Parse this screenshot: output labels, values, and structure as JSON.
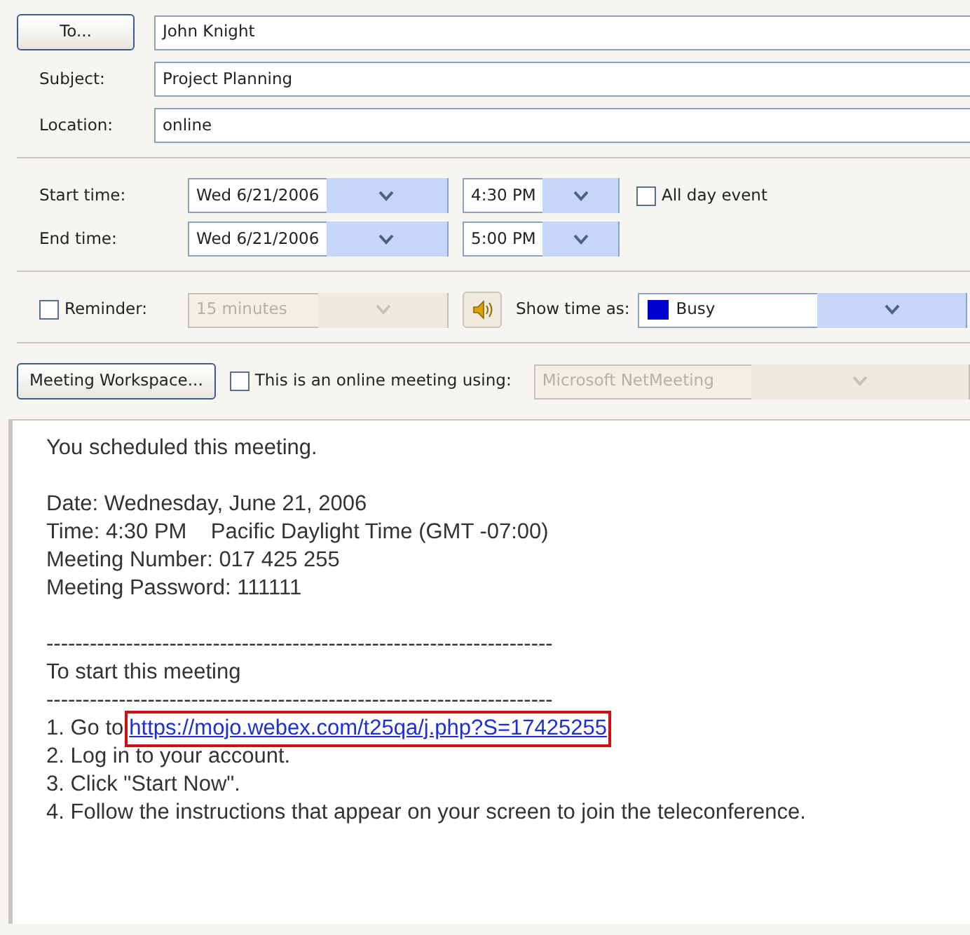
{
  "to_button": "To...",
  "to_value": "John Knight",
  "fields": [
    {
      "label": "Subject:",
      "value": "Project Planning"
    },
    {
      "label": "Location:",
      "value": "online"
    }
  ],
  "times": [
    {
      "label": "Start time:",
      "date": "Wed 6/21/2006",
      "time": "4:30 PM"
    },
    {
      "label": "End time:",
      "date": "Wed 6/21/2006",
      "time": "5:00 PM"
    }
  ],
  "all_day": {
    "label": "All day event",
    "checked": false
  },
  "reminder": {
    "label": "Reminder:",
    "checked": false,
    "value": "15 minutes",
    "disabled": true
  },
  "show_time_as": {
    "label": "Show time as:",
    "value": "Busy",
    "color": "#0000cc"
  },
  "workspace_button": "Meeting Workspace...",
  "online_meeting": {
    "label": "This is an online meeting using:",
    "checked": false,
    "value": "Microsoft NetMeeting",
    "disabled": true
  },
  "body": [
    {
      "kind": "text",
      "text": "You scheduled this meeting."
    },
    {
      "kind": "blank"
    },
    {
      "kind": "text",
      "text": "Date: Wednesday, June 21, 2006"
    },
    {
      "kind": "text",
      "text": "Time: 4:30 PM    Pacific Daylight Time (GMT -07:00)"
    },
    {
      "kind": "text",
      "text": "Meeting Number: 017 425 255"
    },
    {
      "kind": "text",
      "text": "Meeting Password: 111111"
    },
    {
      "kind": "blank"
    },
    {
      "kind": "text",
      "text": "----------------------------------------------------------------------"
    },
    {
      "kind": "text",
      "text": "To start this meeting"
    },
    {
      "kind": "text",
      "text": "----------------------------------------------------------------------"
    },
    {
      "kind": "link",
      "text": "1. Go to",
      "link": "https://mojo.webex.com/t25qa/j.php?S=17425255",
      "highlighted": true
    },
    {
      "kind": "text",
      "text": "2. Log in to your account."
    },
    {
      "kind": "text",
      "text": "3. Click \"Start Now\"."
    },
    {
      "kind": "text",
      "text": "4. Follow the instructions that appear on your screen to join the teleconference."
    }
  ]
}
